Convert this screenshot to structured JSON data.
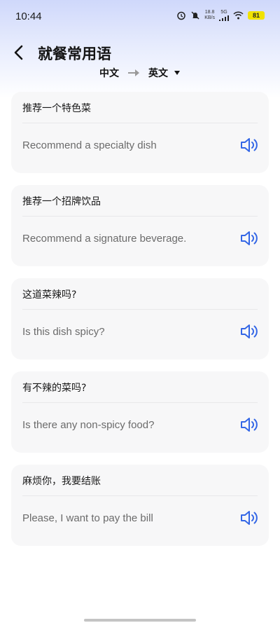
{
  "status": {
    "time": "10:44",
    "speed_value": "18.8",
    "speed_unit": "KB/s",
    "network": "5G",
    "battery": "81"
  },
  "header": {
    "title": "就餐常用语"
  },
  "languages": {
    "source": "中文",
    "target": "英文"
  },
  "phrases": [
    {
      "zh": "推荐一个特色菜",
      "en": "Recommend a specialty dish"
    },
    {
      "zh": "推荐一个招牌饮品",
      "en": "Recommend a signature beverage."
    },
    {
      "zh": "这道菜辣吗?",
      "en": "Is this dish spicy?"
    },
    {
      "zh": "有不辣的菜吗?",
      "en": "Is there any non-spicy food?"
    },
    {
      "zh": "麻烦你，我要结账",
      "en": "Please, I want to pay the bill"
    }
  ],
  "colors": {
    "accent": "#3366e6",
    "card_bg": "#f7f7f8",
    "battery": "#f1e200"
  },
  "icons": {
    "back": "back-arrow-icon",
    "swap": "arrow-right-icon",
    "dropdown": "caret-down-icon",
    "speaker": "speaker-icon"
  }
}
